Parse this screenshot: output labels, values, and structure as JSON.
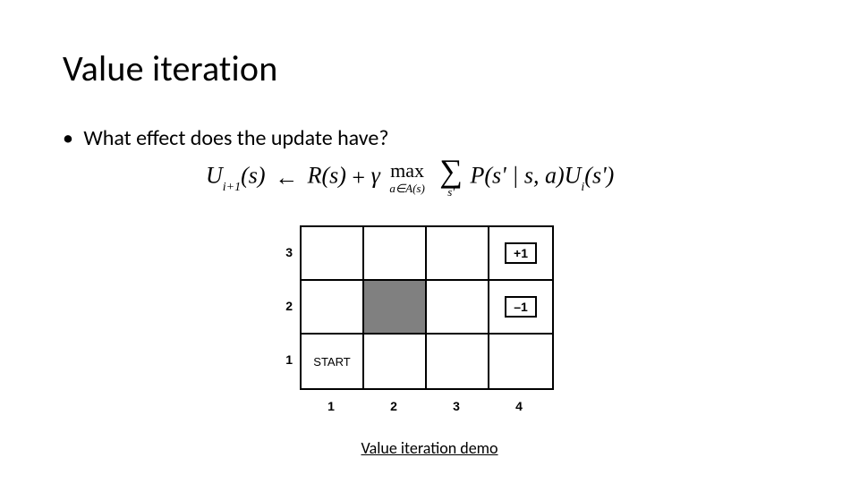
{
  "title": "Value iteration",
  "bullet": "What effect does the update have?",
  "equation": {
    "lhs_u": "U",
    "lhs_sub": "i+1",
    "lhs_arg": "(s)",
    "arrow": "←",
    "r": "R(s)",
    "plus": "+",
    "gamma": "γ",
    "max": "max",
    "max_sub": "a∈A(s)",
    "sigma": "∑",
    "sigma_sub": "s'",
    "p": "P(s' | s, a)",
    "u2": "U",
    "u2_sub": "i",
    "u2_arg": "(s')"
  },
  "grid": {
    "rows": [
      "3",
      "2",
      "1"
    ],
    "cols": [
      "1",
      "2",
      "3",
      "4"
    ],
    "start_label": "START",
    "reward_top": "+1",
    "reward_bot": "–1"
  },
  "demo_link": "Value iteration demo"
}
